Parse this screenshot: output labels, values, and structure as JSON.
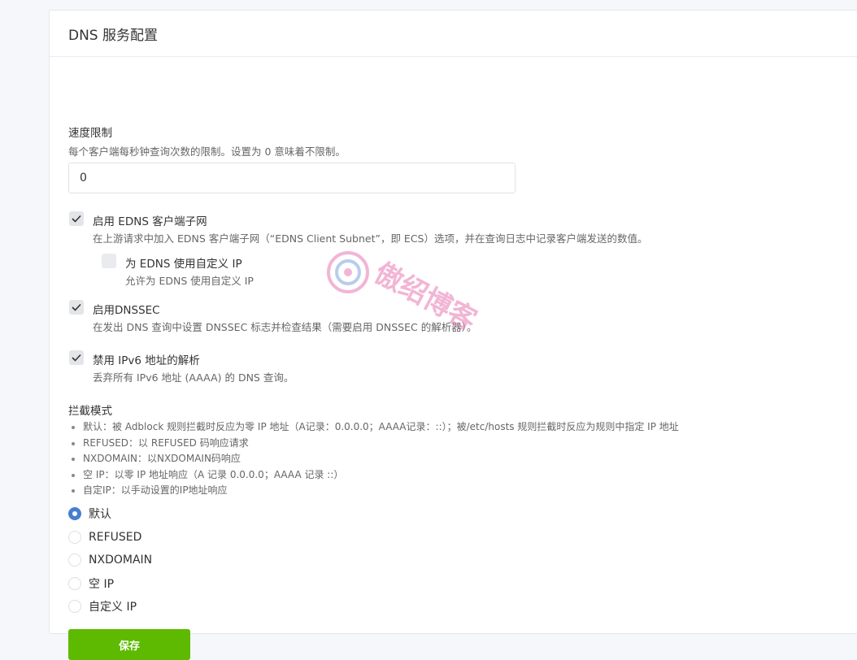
{
  "card": {
    "title": "DNS 服务配置"
  },
  "ratelimit": {
    "label": "速度限制",
    "help": "每个客户端每秒钟查询次数的限制。设置为 0 意味着不限制。",
    "value": "0"
  },
  "edns": {
    "label": "启用 EDNS 客户端子网",
    "help": "在上游请求中加入 EDNS 客户端子网（“EDNS Client Subnet”，即 ECS）选项，并在查询日志中记录客户端发送的数值。",
    "checked": true
  },
  "edns_custom": {
    "label": "为 EDNS 使用自定义 IP",
    "help": "允许为 EDNS 使用自定义 IP",
    "checked": false
  },
  "dnssec": {
    "label": "启用DNSSEC",
    "help": "在发出 DNS 查询中设置 DNSSEC 标志并检查结果（需要启用 DNSSEC 的解析器）。",
    "checked": true
  },
  "ipv6": {
    "label": "禁用 IPv6 地址的解析",
    "help": "丢弃所有 IPv6 地址 (AAAA) 的 DNS 查询。",
    "checked": true
  },
  "blocking": {
    "label": "拦截模式",
    "rules": [
      "默认：被 Adblock 规则拦截时反应为零 IP 地址（A记录：0.0.0.0；AAAA记录：::）；被/etc/hosts 规则拦截时反应为规则中指定 IP 地址",
      "REFUSED：以 REFUSED 码响应请求",
      "NXDOMAIN：以NXDOMAIN码响应",
      "空 IP：以零 IP 地址响应（A 记录 0.0.0.0；AAAA 记录 ::）",
      "自定IP：以手动设置的IP地址响应"
    ],
    "options": [
      "默认",
      "REFUSED",
      "NXDOMAIN",
      "空 IP",
      "自定义 IP"
    ],
    "selected": "默认"
  },
  "save_label": "保存",
  "watermark_text": "傲绍博客",
  "colors": {
    "primary": "#467fcf",
    "success": "#5eba00",
    "watermark": "#e87ab3"
  }
}
